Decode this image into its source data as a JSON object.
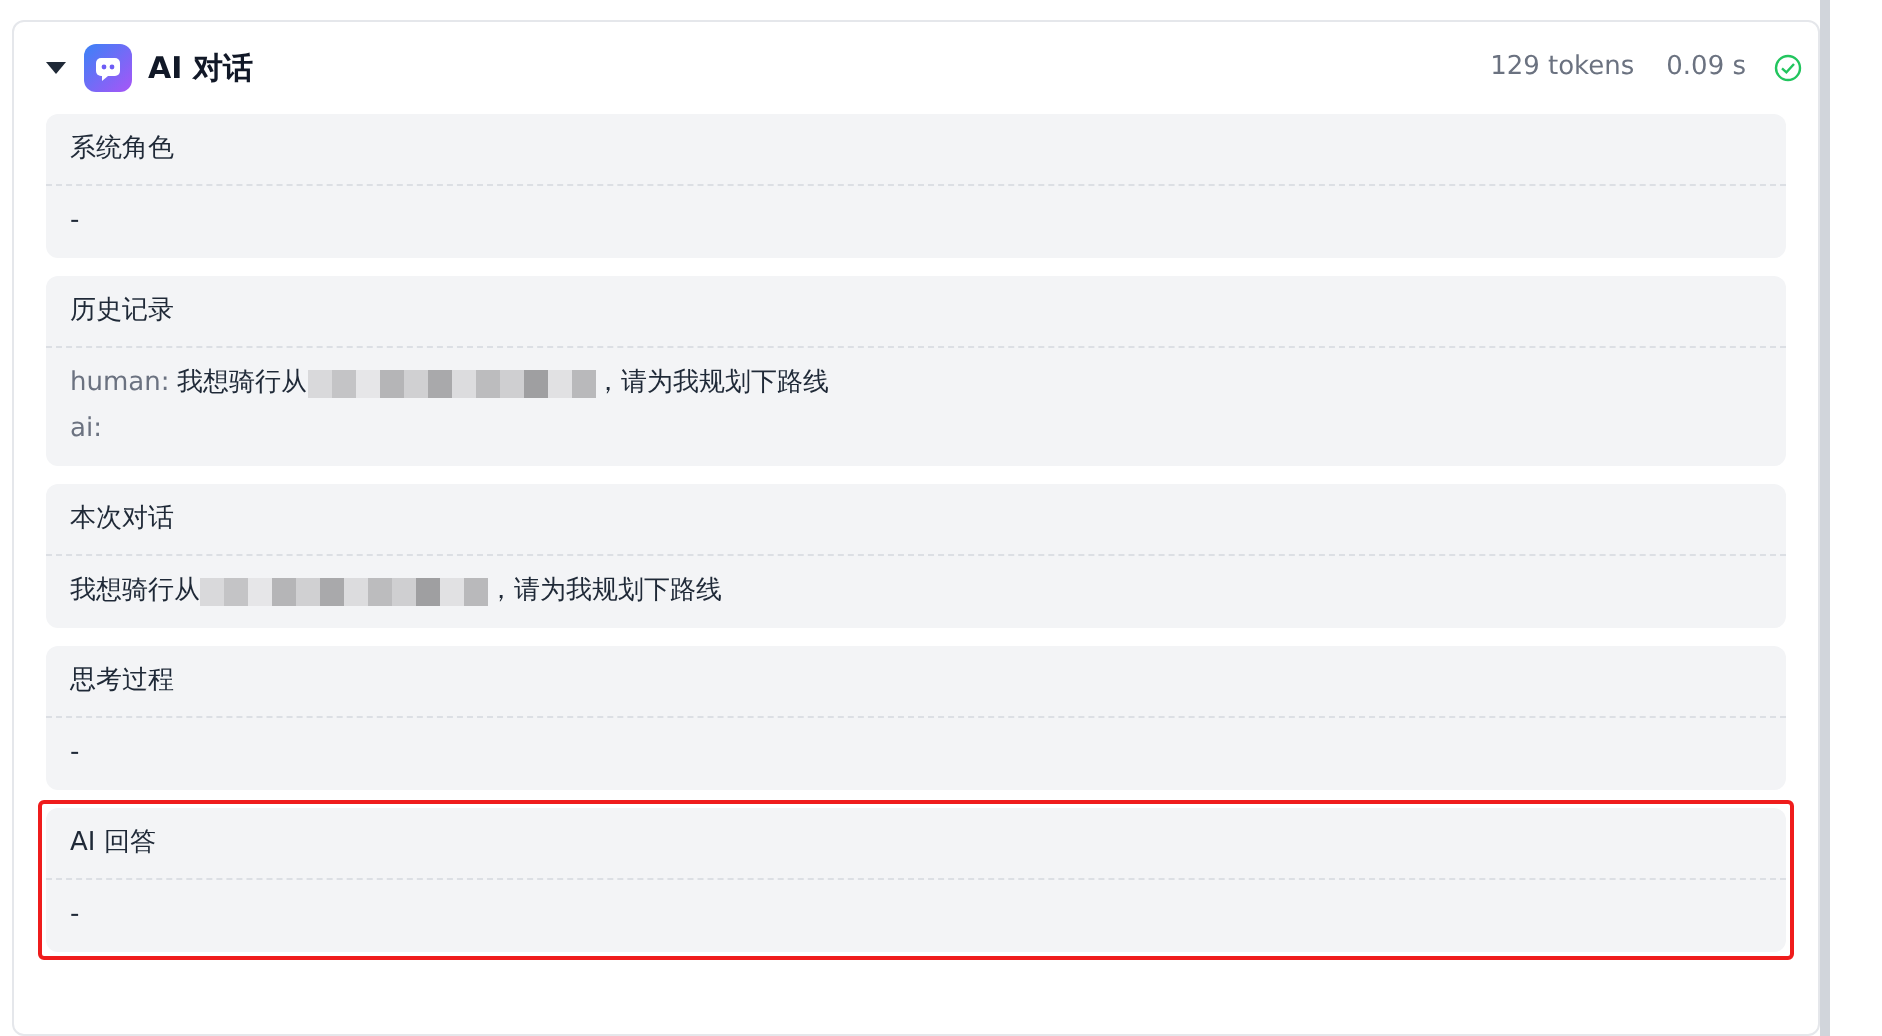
{
  "node": {
    "expanded": true,
    "title": "AI 对话",
    "tokens": "129 tokens",
    "duration": "0.09 s",
    "success": true
  },
  "sections": [
    {
      "title": "系统角色",
      "highlighted": false,
      "lines": [
        [
          {
            "kind": "text",
            "text": "-"
          }
        ]
      ]
    },
    {
      "title": "历史记录",
      "highlighted": false,
      "lines": [
        [
          {
            "kind": "speaker",
            "text": "human:"
          },
          {
            "kind": "text",
            "text": "我想骑行从"
          },
          {
            "kind": "redacted"
          },
          {
            "kind": "text",
            "text": "，请为我规划下路线"
          }
        ],
        [
          {
            "kind": "speaker",
            "text": "ai:"
          }
        ]
      ]
    },
    {
      "title": "本次对话",
      "highlighted": false,
      "lines": [
        [
          {
            "kind": "text",
            "text": "我想骑行从"
          },
          {
            "kind": "redacted"
          },
          {
            "kind": "text",
            "text": "，请为我规划下路线"
          }
        ]
      ]
    },
    {
      "title": "思考过程",
      "highlighted": false,
      "lines": [
        [
          {
            "kind": "text",
            "text": "-"
          }
        ]
      ]
    },
    {
      "title": "AI 回答",
      "highlighted": true,
      "lines": [
        [
          {
            "kind": "text",
            "text": "-"
          }
        ]
      ]
    }
  ]
}
